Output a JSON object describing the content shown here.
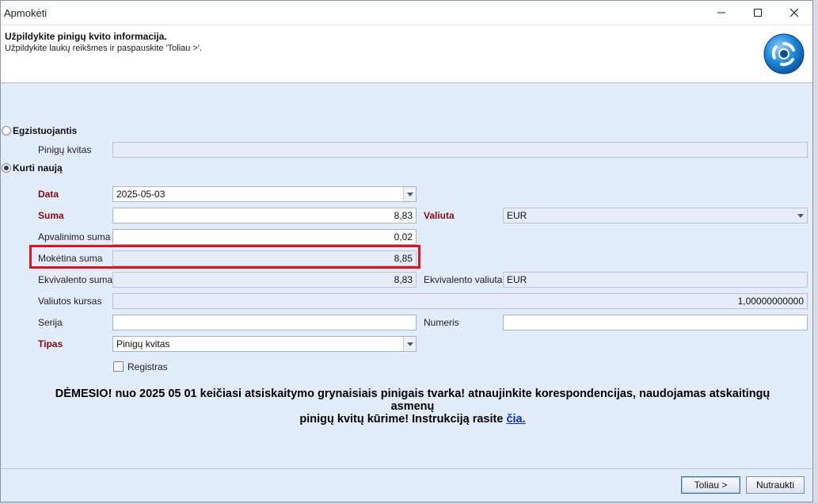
{
  "window": {
    "title": "Apmokėti"
  },
  "header": {
    "title": "Užpildykite pinigų kvito informacija.",
    "subtitle": "Užpildykite laukų reikšmes ir paspauskite 'Toliau >'."
  },
  "options": {
    "existing_label": "Egzistuojantis",
    "existing_selected": false,
    "new_label": "Kurti naują",
    "new_selected": true
  },
  "form": {
    "pinigu_kvitas_label": "Pinigų kvitas",
    "pinigu_kvitas_value": "",
    "data_label": "Data",
    "data_value": "2025-05-03",
    "suma_label": "Suma",
    "suma_value": "8,83",
    "valiuta_label": "Valiuta",
    "valiuta_value": "EUR",
    "apvalinimo_label": "Apvalinimo suma",
    "apvalinimo_value": "0,02",
    "موketina_placeholder": "",
    "moketina_label": "Mokėtina suma",
    "moketina_value": "8,85",
    "ekvivalento_suma_label": "Ekvivalento suma",
    "ekvivalento_suma_value": "8,83",
    "ekvivalento_valiuta_label": "Ekvivalento valiuta",
    "ekvivalento_valiuta_value": "EUR",
    "kursas_label": "Valiutos kursas",
    "kursas_value": "1,00000000000",
    "serija_label": "Serija",
    "serija_value": "",
    "numeris_label": "Numeris",
    "numeris_value": "",
    "tipas_label": "Tipas",
    "tipas_value": "Pinigų kvitas",
    "registras_label": "Registras",
    "registras_checked": false
  },
  "notice": {
    "line1": "DĖMESIO! nuo 2025 05 01 keičiasi atsiskaitymo grynaisiais pinigais tvarka! atnaujinkite korespondencijas, naudojamas atskaitingų asmenų",
    "line2": "pinigų kvitų kūrime! Instrukciją rasite ",
    "link": "čia."
  },
  "buttons": {
    "next": "Toliau >",
    "cancel": "Nutraukti"
  },
  "colors": {
    "required_label": "#7d0d12",
    "highlight_border": "#e0131b",
    "link": "#0a2bd6"
  }
}
